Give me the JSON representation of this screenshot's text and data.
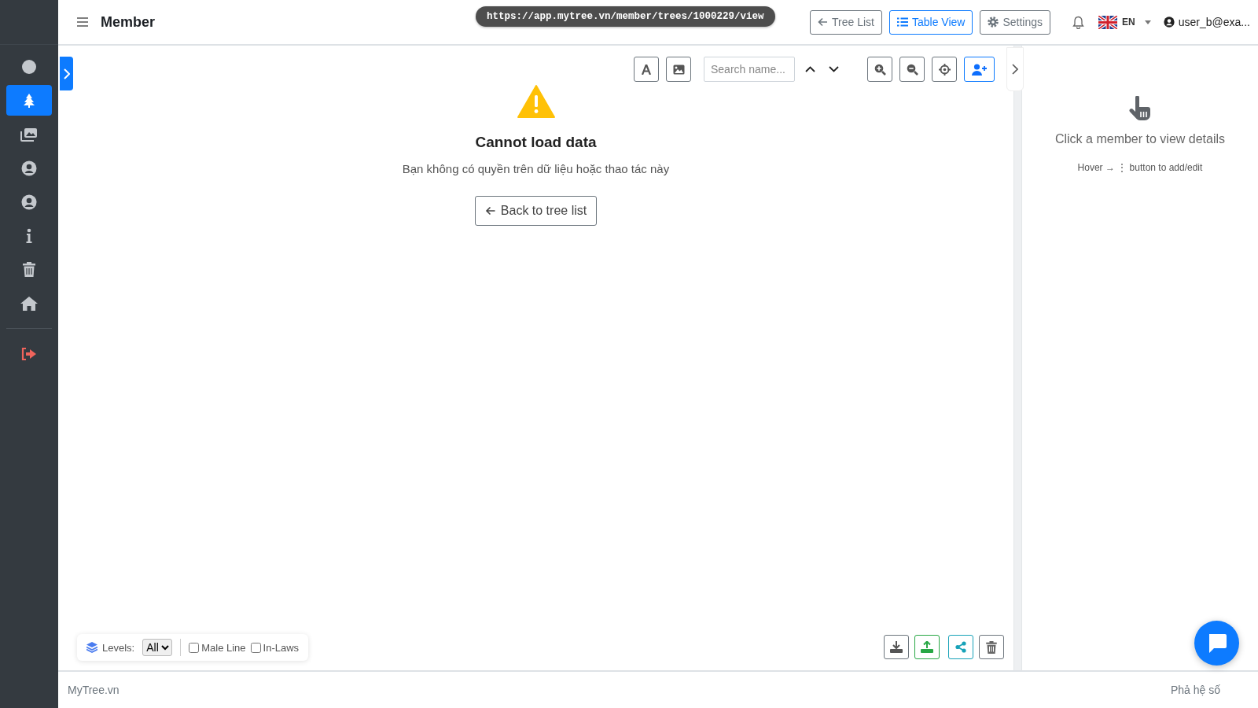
{
  "header": {
    "title": "Member",
    "url": "https://app.mytree.vn/member/trees/1000229/view",
    "buttons": [
      {
        "label": "Tree List",
        "kind": "back",
        "selected": false
      },
      {
        "label": "Table View",
        "kind": "list",
        "selected": true
      },
      {
        "label": "Settings",
        "kind": "gear",
        "selected": false
      }
    ],
    "language": "EN",
    "user": "user_b@exa..."
  },
  "sidebar": {
    "items": [
      {
        "kind": "circle",
        "selected": false
      },
      {
        "kind": "tree",
        "selected": true
      },
      {
        "kind": "images",
        "selected": false
      },
      {
        "kind": "user",
        "selected": false
      },
      {
        "kind": "user",
        "selected": false
      },
      {
        "kind": "info",
        "selected": false
      },
      {
        "kind": "trash",
        "selected": false
      },
      {
        "kind": "home",
        "selected": false
      },
      {
        "kind": "logout",
        "selected": false
      }
    ]
  },
  "toolbar": {
    "search": {
      "placeholder": "Search name..."
    }
  },
  "message": {
    "title": "Cannot load data",
    "text": "Bạn không có quyền trên dữ liệu hoặc thao tác này",
    "button": "Back to tree list"
  },
  "details_panel": {
    "title": "Click a member to view details",
    "hint": "Hover → ⋮ button to add/edit"
  },
  "filters": {
    "levels_label": "Levels:",
    "levels_value": "All",
    "options": [
      {
        "label": "Male Line",
        "checked": false
      },
      {
        "label": "In-Laws",
        "checked": false
      }
    ]
  },
  "footer": {
    "left": "MyTree.vn",
    "right": "Phả hệ số"
  }
}
